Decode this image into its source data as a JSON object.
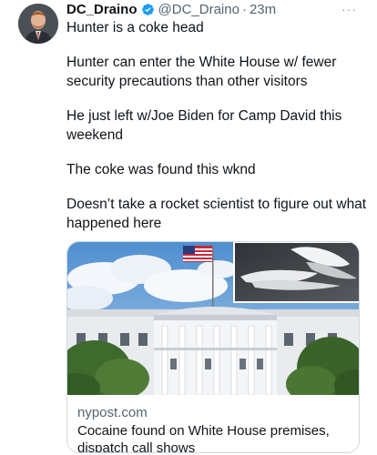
{
  "tweet": {
    "display_name": "DC_Draino",
    "handle": "@DC_Draino",
    "separator": "·",
    "time": "23m",
    "more_label": "···",
    "paragraphs": [
      "Hunter is a coke head",
      "Hunter can enter the White House w/ fewer security precautions than other visitors",
      "He just left w/Joe Biden for Camp David this weekend",
      "The coke was found this wknd",
      "Doesn’t take a rocket scientist to figure out what happened here"
    ]
  },
  "link_card": {
    "domain": "nypost.com",
    "headline": "Cocaine found on White House premises, dispatch call shows"
  },
  "colors": {
    "verified_badge": "#1d9bf0",
    "secondary_text": "#536471"
  },
  "icons": {
    "verified": "verified-badge-icon",
    "more": "more-options-icon"
  }
}
